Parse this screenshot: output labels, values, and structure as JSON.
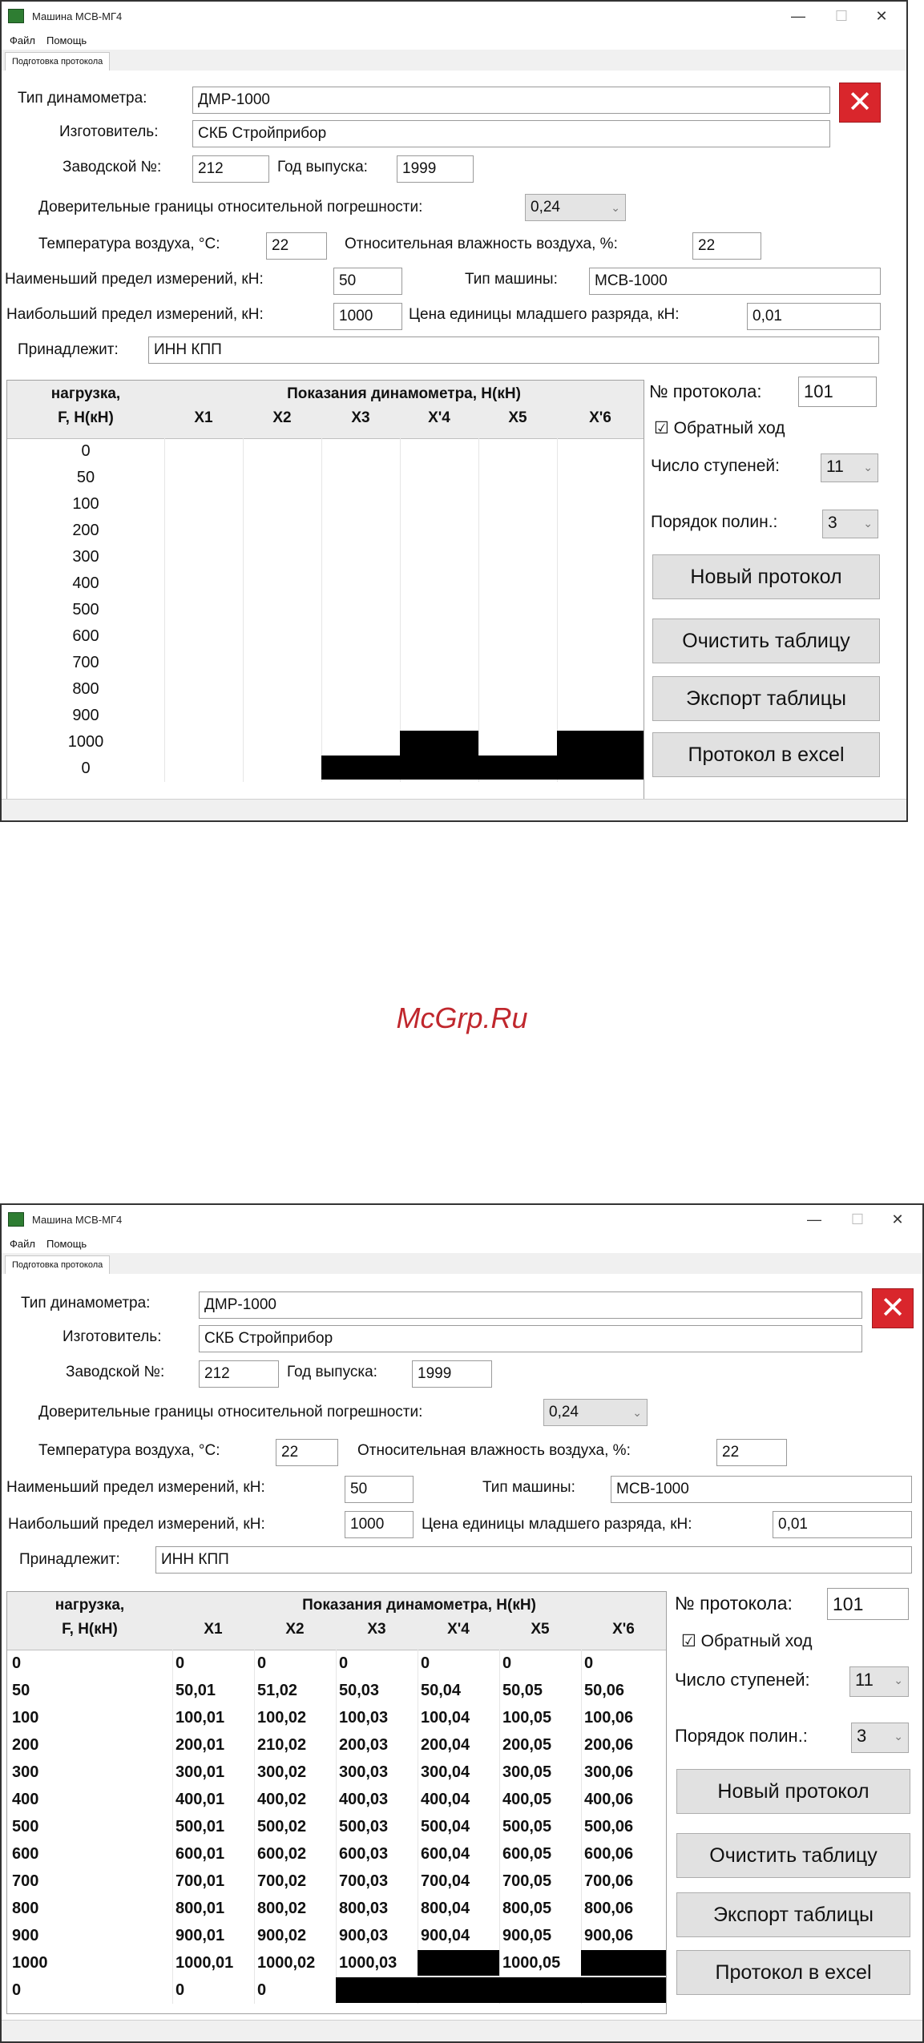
{
  "window": {
    "title": "Машина МСВ-МГ4",
    "minimize_glyph": "—",
    "maximize_glyph": "☐",
    "close_glyph": "✕",
    "menu": [
      "Файл",
      "Помощь"
    ],
    "tab": "Подготовка протокола"
  },
  "form": {
    "dyn_type_label": "Тип динамометра:",
    "dyn_type_value": "ДМР-1000",
    "manufacturer_label": "Изготовитель:",
    "manufacturer_value": "СКБ Стройприбор",
    "serial_label": "Заводской №:",
    "serial_value": "212",
    "year_label": "Год выпуска:",
    "year_value": "1999",
    "confidence_label": "Доверительные границы относительной погрешности:",
    "confidence_value": "0,24",
    "temp_label": "Температура воздуха, °С:",
    "temp_value": "22",
    "humidity_label": "Относительная влажность воздуха, %:",
    "humidity_value": "22",
    "min_limit_label": "Наименьший предел измерений, кН:",
    "min_limit_value": "50",
    "machine_type_label": "Тип машины:",
    "machine_type_value": "МСВ-1000",
    "max_limit_label": "Наибольший предел измерений, кН:",
    "max_limit_value": "1000",
    "unit_price_label": "Цена единицы младшего разряда, кН:",
    "unit_price_value": "0,01",
    "owner_label": "Принадлежит:",
    "owner_value": "ИНН КПП",
    "clear_icon_glyph": "✕"
  },
  "table": {
    "load_header_1": "нагрузка,",
    "load_header_2": "F, Н(кН)",
    "readings_header": "Показания динамометра, Н(кН)",
    "columns": [
      "X1",
      "X2",
      "X3",
      "X'4",
      "X5",
      "X'6"
    ],
    "loads": [
      "0",
      "50",
      "100",
      "200",
      "300",
      "400",
      "500",
      "600",
      "700",
      "800",
      "900",
      "1000",
      "0"
    ],
    "filled_rows": [
      [
        "0",
        "0",
        "0",
        "0",
        "0",
        "0"
      ],
      [
        "50,01",
        "51,02",
        "50,03",
        "50,04",
        "50,05",
        "50,06"
      ],
      [
        "100,01",
        "100,02",
        "100,03",
        "100,04",
        "100,05",
        "100,06"
      ],
      [
        "200,01",
        "210,02",
        "200,03",
        "200,04",
        "200,05",
        "200,06"
      ],
      [
        "300,01",
        "300,02",
        "300,03",
        "300,04",
        "300,05",
        "300,06"
      ],
      [
        "400,01",
        "400,02",
        "400,03",
        "400,04",
        "400,05",
        "400,06"
      ],
      [
        "500,01",
        "500,02",
        "500,03",
        "500,04",
        "500,05",
        "500,06"
      ],
      [
        "600,01",
        "600,02",
        "600,03",
        "600,04",
        "600,05",
        "600,06"
      ],
      [
        "700,01",
        "700,02",
        "700,03",
        "700,04",
        "700,05",
        "700,06"
      ],
      [
        "800,01",
        "800,02",
        "800,03",
        "800,04",
        "800,05",
        "800,06"
      ],
      [
        "900,01",
        "900,02",
        "900,03",
        "900,04",
        "900,05",
        "900,06"
      ],
      [
        "1000,01",
        "1000,02",
        "1000,03",
        "",
        "1000,05",
        ""
      ],
      [
        "0",
        "0",
        "",
        "",
        "",
        ""
      ]
    ]
  },
  "side": {
    "protocol_label": "№ протокола:",
    "protocol_value": "101",
    "reverse_label": "☑ Обратный ход",
    "steps_label": "Число ступеней:",
    "steps_value": "11",
    "poly_label": "Порядок полин.:",
    "poly_value": "3",
    "new_protocol": "Новый протокол",
    "clear_table": "Очистить таблицу",
    "export_table": "Экспорт таблицы",
    "excel": "Протокол в excel",
    "dropdown_glyph": "⌄"
  },
  "watermark": "McGrp.Ru"
}
